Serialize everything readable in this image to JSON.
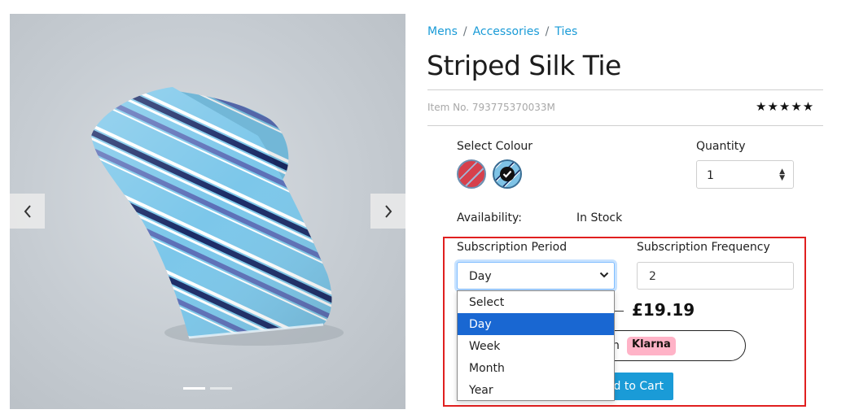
{
  "breadcrumb": [
    "Mens",
    "Accessories",
    "Ties"
  ],
  "product": {
    "title": "Striped Silk Tie",
    "item_no": "Item No. 793775370033M",
    "rating_stars": "★★★★★",
    "image_alt": "blue striped silk tie"
  },
  "gallery": {
    "slide_count": 2,
    "active_slide": 1
  },
  "colour": {
    "label": "Select Colour",
    "swatches": [
      {
        "name": "red-stripe",
        "color": "#d6404c",
        "selected": false
      },
      {
        "name": "blue-stripe",
        "color": "#7fc3e6",
        "selected": true
      }
    ]
  },
  "quantity": {
    "label": "Quantity",
    "value": "1"
  },
  "availability": {
    "label": "Availability:",
    "value": "In Stock"
  },
  "subscription": {
    "period_label": "Subscription Period",
    "period_value": "Day",
    "period_options": [
      "Select",
      "Day",
      "Week",
      "Month",
      "Year"
    ],
    "selected_index": 1,
    "frequency_label": "Subscription Frequency",
    "frequency_value": "2"
  },
  "price": "£19.19",
  "klarna": {
    "text": "h",
    "badge": "Klarna"
  },
  "cart_button": "ld to Cart",
  "colors": {
    "accent": "#1a9bd7",
    "highlight": "#e02020",
    "dropdown_selected": "#1967d2",
    "klarna_pink": "#ffb3c7"
  }
}
